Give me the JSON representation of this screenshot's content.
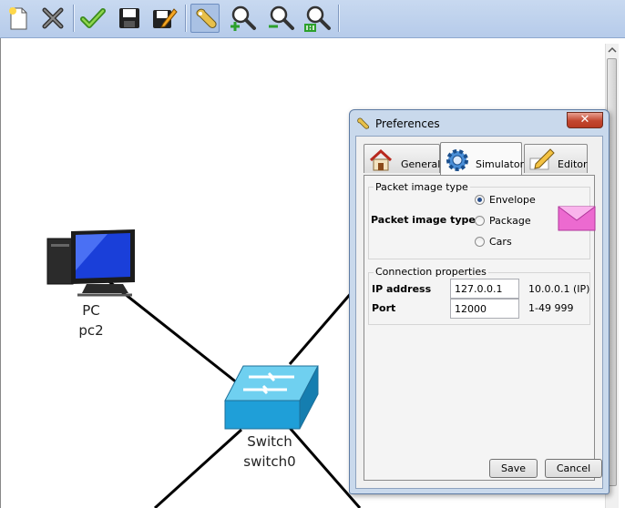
{
  "toolbar": {
    "buttons": [
      {
        "name": "new",
        "icon": "new-document-icon"
      },
      {
        "name": "delete",
        "icon": "delete-x-icon"
      },
      {
        "name": "check",
        "icon": "checkmark-icon"
      },
      {
        "name": "save",
        "icon": "floppy-disk-icon"
      },
      {
        "name": "save-as",
        "icon": "floppy-pencil-icon"
      },
      {
        "name": "preferences",
        "icon": "wrench-icon",
        "active": true
      },
      {
        "name": "zoom-in",
        "icon": "zoom-in-icon"
      },
      {
        "name": "zoom-out",
        "icon": "zoom-out-icon"
      },
      {
        "name": "zoom-reset",
        "icon": "zoom-1to1-icon"
      }
    ]
  },
  "canvas": {
    "nodes": [
      {
        "type": "PC",
        "name": "pc2",
        "icon": "pc-icon"
      },
      {
        "type": "Switch",
        "name": "switch0",
        "icon": "switch-icon"
      }
    ]
  },
  "dialog": {
    "title": "Preferences",
    "tabs": [
      {
        "label": "General",
        "icon": "house-icon"
      },
      {
        "label": "Simulator",
        "icon": "gear-icon",
        "selected": true
      },
      {
        "label": "Editor",
        "icon": "pencil-icon"
      }
    ],
    "packet_group": {
      "title": "Packet image type",
      "label": "Packet image type",
      "options": [
        {
          "label": "Envelope",
          "selected": true
        },
        {
          "label": "Package",
          "selected": false
        },
        {
          "label": "Cars",
          "selected": false
        }
      ],
      "preview_icon": "envelope-icon"
    },
    "connection_group": {
      "title": "Connection properties",
      "ip_label": "IP address",
      "ip_value": "127.0.0.1",
      "ip_hint": "10.0.0.1 (IP)",
      "port_label": "Port",
      "port_value": "12000",
      "port_hint": "1-49 999"
    },
    "save_label": "Save",
    "cancel_label": "Cancel"
  },
  "colors": {
    "toolbar_bg": "#c2d5ee",
    "dialog_frame": "#c9d9ec",
    "close_button": "#c2462f",
    "envelope": "#e85fc8"
  }
}
